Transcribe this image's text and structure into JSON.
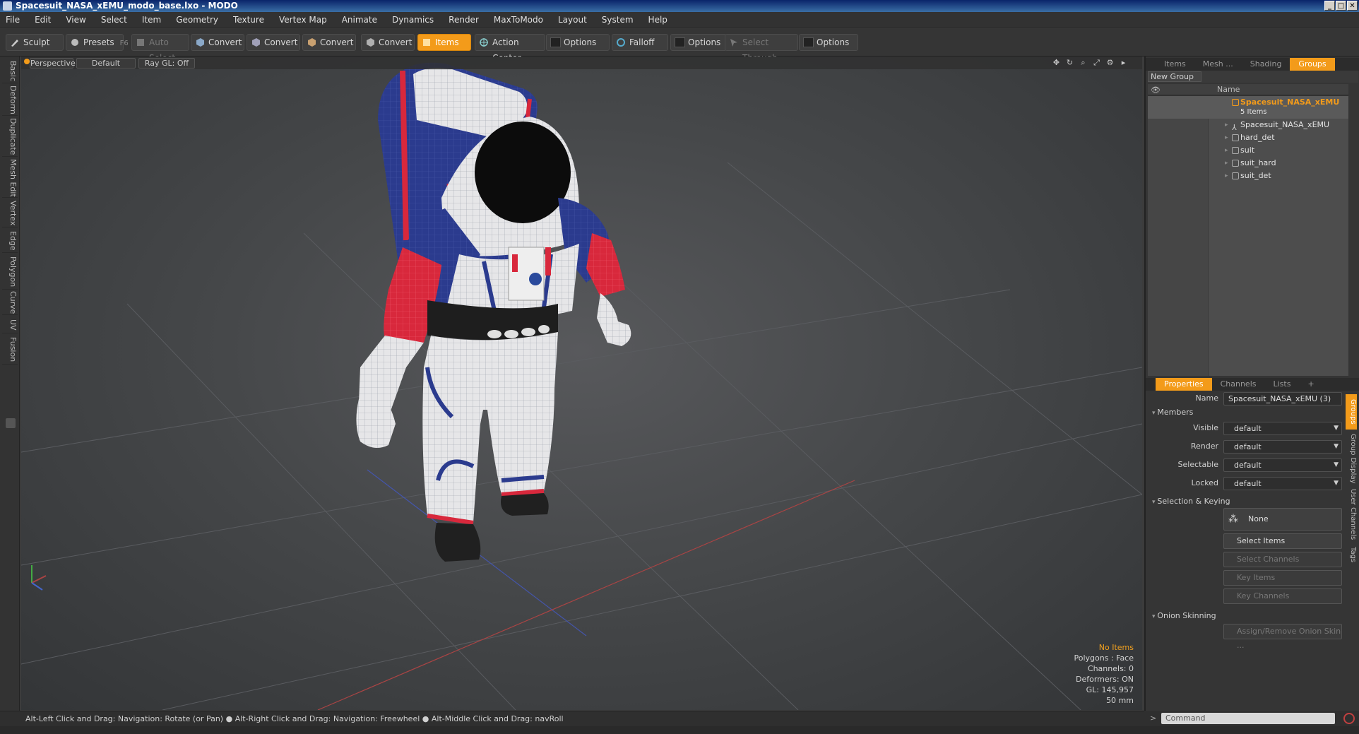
{
  "window": {
    "title": "Spacesuit_NASA_xEMU_modo_base.lxo - MODO",
    "buttons": [
      "_",
      "□",
      "✕"
    ]
  },
  "menu": [
    "File",
    "Edit",
    "View",
    "Select",
    "Item",
    "Geometry",
    "Texture",
    "Vertex Map",
    "Animate",
    "Dynamics",
    "Render",
    "MaxToModo",
    "Layout",
    "System",
    "Help"
  ],
  "toolbar": {
    "sculpt": "Sculpt",
    "presets": "Presets",
    "presets_key": "F6",
    "auto_select": "Auto Select",
    "convert1": "Convert",
    "convert2": "Convert",
    "convert3": "Convert",
    "convert4": "Convert",
    "items": "Items",
    "action_center": "Action Center",
    "options1": "Options",
    "falloff": "Falloff",
    "options2": "Options",
    "select_through": "Select Through",
    "options3": "Options"
  },
  "left_tabs": [
    "Basic",
    "Deform",
    "Duplicate",
    "Mesh Edit",
    "Vertex",
    "Edge",
    "Polygon",
    "Curve",
    "UV",
    "Fusion"
  ],
  "viewport": {
    "view": "Perspective",
    "shading": "Default",
    "raygl": "Ray GL: Off",
    "info": {
      "selection": "No Items",
      "polygons": "Polygons : Face",
      "channels": "Channels: 0",
      "deformers": "Deformers: ON",
      "gl": "GL: 145,957",
      "size": "50 mm"
    }
  },
  "status": "Alt-Left Click and Drag: Navigation: Rotate (or Pan) ● Alt-Right Click and Drag: Navigation: Freewheel ● Alt-Middle Click and Drag: navRoll",
  "panel_top": {
    "tabs": [
      "Items",
      "Mesh ...",
      "Shading",
      "Groups"
    ],
    "new_group": "New Group",
    "name_col": "Name",
    "group": {
      "name": "Spacesuit_NASA_xEMU",
      "count": "5 Items"
    },
    "members": [
      "Spacesuit_NASA_xEMU",
      "hard_det",
      "suit",
      "suit_hard",
      "suit_det"
    ]
  },
  "panel_bottom": {
    "tabs": [
      "Properties",
      "Channels",
      "Lists",
      "+"
    ],
    "name_label": "Name",
    "name_value": "Spacesuit_NASA_xEMU (3)",
    "members_hdr": "Members",
    "visible_label": "Visible",
    "visible_value": "default",
    "render_label": "Render",
    "render_value": "default",
    "selectable_label": "Selectable",
    "selectable_value": "default",
    "locked_label": "Locked",
    "locked_value": "default",
    "sel_hdr": "Selection & Keying",
    "none_btn": "None",
    "select_items": "Select Items",
    "select_channels": "Select Channels",
    "key_items": "Key Items",
    "key_channels": "Key Channels",
    "onion_hdr": "Onion Skinning",
    "assign_onion": "Assign/Remove Onion Skin ..."
  },
  "side_tabs": [
    "Groups",
    "Group Display",
    "User Channels",
    "Tags"
  ],
  "command": {
    "placeholder": "Command"
  },
  "colors": {
    "accent": "#f39b1a",
    "suit_red": "#d9283a",
    "suit_blue": "#2a3a8c",
    "suit_white": "#e8e8ea"
  }
}
